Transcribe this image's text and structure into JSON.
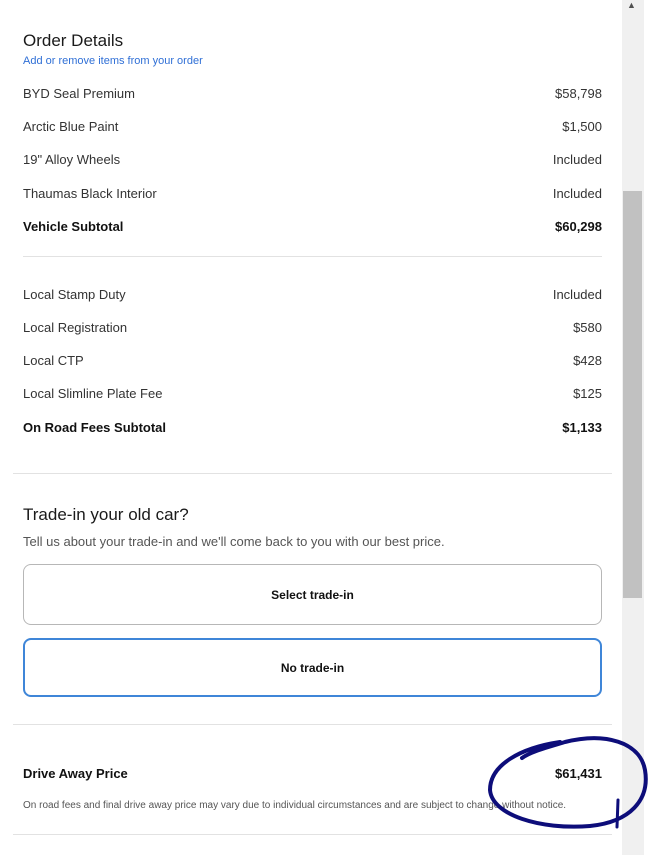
{
  "order_details": {
    "title": "Order Details",
    "edit_link": "Add or remove items from your order",
    "vehicle_items": [
      {
        "label": "BYD Seal Premium",
        "value": "$58,798"
      },
      {
        "label": "Arctic Blue Paint",
        "value": "$1,500"
      },
      {
        "label": "19\" Alloy Wheels",
        "value": "Included"
      },
      {
        "label": "Thaumas Black Interior",
        "value": "Included"
      }
    ],
    "vehicle_subtotal": {
      "label": "Vehicle Subtotal",
      "value": "$60,298"
    },
    "fee_items": [
      {
        "label": "Local Stamp Duty",
        "value": "Included"
      },
      {
        "label": "Local Registration",
        "value": "$580"
      },
      {
        "label": "Local CTP",
        "value": "$428"
      },
      {
        "label": "Local Slimline Plate Fee",
        "value": "$125"
      }
    ],
    "fees_subtotal": {
      "label": "On Road Fees Subtotal",
      "value": "$1,133"
    }
  },
  "trade_in": {
    "title": "Trade-in your old car?",
    "subtitle": "Tell us about your trade-in and we'll come back to you with our best price.",
    "select_label": "Select trade-in",
    "none_label": "No trade-in"
  },
  "drive_away": {
    "label": "Drive Away Price",
    "value": "$61,431",
    "disclaimer": "On road fees and final drive away price may vary due to individual circumstances and are subject to change without notice."
  },
  "colors": {
    "link": "#2f6fd6",
    "selected_border": "#3f86d8",
    "annotation": "#0d0d7a"
  }
}
